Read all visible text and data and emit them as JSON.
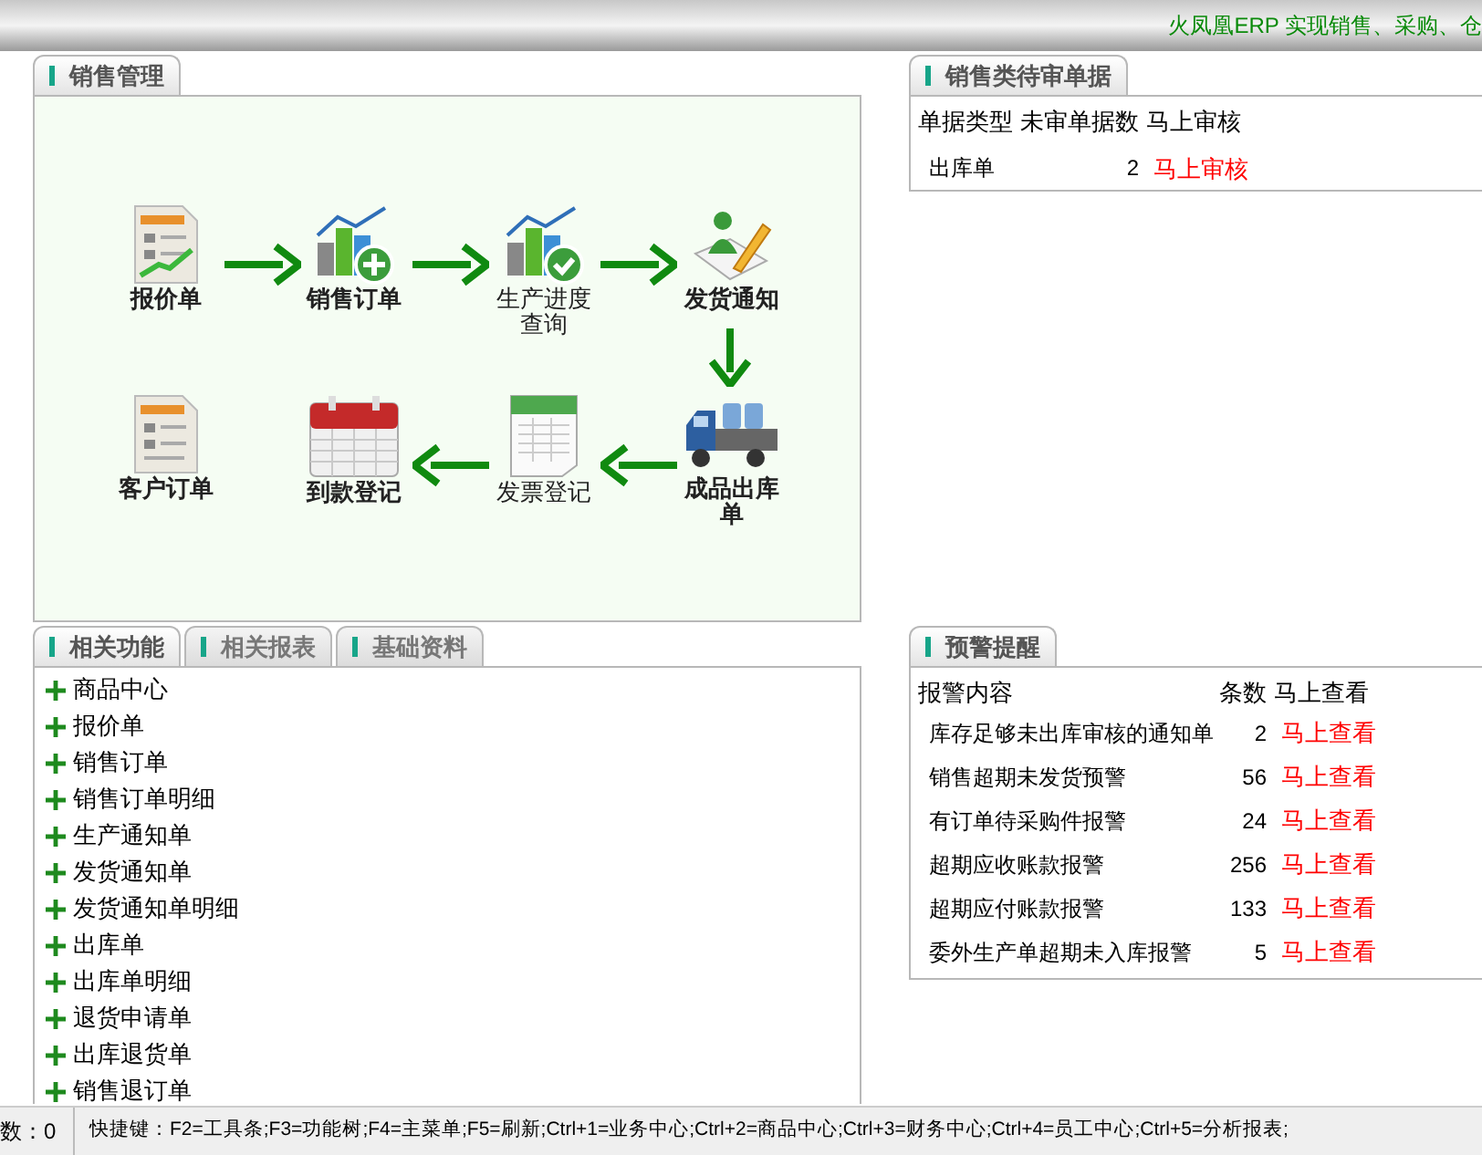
{
  "header": {
    "text": "火凤凰ERP 实现销售、采购、仓"
  },
  "sales_panel": {
    "tab": "销售管理",
    "nodes": [
      {
        "label": "报价单",
        "kind": "quote",
        "bold": true
      },
      {
        "label": "销售订单",
        "kind": "order",
        "bold": true
      },
      {
        "label": "生产进度查询",
        "kind": "progress",
        "bold": false
      },
      {
        "label": "发货通知",
        "kind": "notice",
        "bold": true
      },
      {
        "label": "客户订单",
        "kind": "customer",
        "bold": true
      },
      {
        "label": "到款登记",
        "kind": "payment",
        "bold": true
      },
      {
        "label": "发票登记",
        "kind": "invoice",
        "bold": false
      },
      {
        "label": "成品出库单",
        "kind": "outbound",
        "bold": true
      }
    ],
    "arrows": [
      {
        "kind": "right"
      },
      {
        "kind": "right"
      },
      {
        "kind": "right"
      },
      {
        "kind": "down"
      },
      {
        "kind": "left"
      },
      {
        "kind": "left"
      }
    ]
  },
  "pending_panel": {
    "tab": "销售类待审单据",
    "columns": [
      "单据类型",
      "未审单据数",
      "马上审核"
    ],
    "rows": [
      {
        "type": "出库单",
        "count": "2",
        "action": "马上审核"
      }
    ]
  },
  "related_panel": {
    "tabs": [
      {
        "label": "相关功能",
        "selected": true
      },
      {
        "label": "相关报表",
        "selected": false
      },
      {
        "label": "基础资料",
        "selected": false
      }
    ],
    "items": [
      "商品中心",
      "报价单",
      "销售订单",
      "销售订单明细",
      "生产通知单",
      "发货通知单",
      "发货通知单明细",
      "出库单",
      "出库单明细",
      "退货申请单",
      "出库退货单",
      "销售退订单"
    ]
  },
  "alert_panel": {
    "tab": "预警提醒",
    "columns": [
      "报警内容",
      "条数",
      "马上查看"
    ],
    "rows": [
      {
        "content": "库存足够未出库审核的通知单",
        "count": "2",
        "action": "马上查看"
      },
      {
        "content": "销售超期未发货预警",
        "count": "56",
        "action": "马上查看"
      },
      {
        "content": "有订单待采购件报警",
        "count": "24",
        "action": "马上查看"
      },
      {
        "content": "超期应收账款报警",
        "count": "256",
        "action": "马上查看"
      },
      {
        "content": "超期应付账款报警",
        "count": "133",
        "action": "马上查看"
      },
      {
        "content": "委外生产单超期未入库报警",
        "count": "5",
        "action": "马上查看"
      }
    ]
  },
  "status_bar": {
    "left": "数：0",
    "shortcuts": "快捷键：F2=工具条;F3=功能树;F4=主菜单;F5=刷新;Ctrl+1=业务中心;Ctrl+2=商品中心;Ctrl+3=财务中心;Ctrl+4=员工中心;Ctrl+5=分析报表;"
  }
}
